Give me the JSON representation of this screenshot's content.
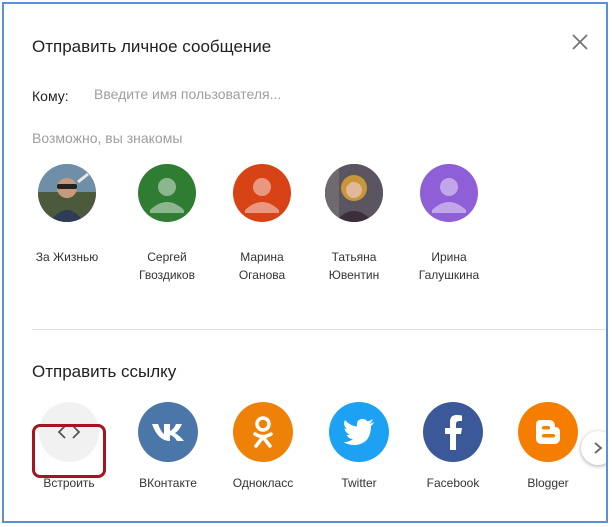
{
  "dialog": {
    "title": "Отправить личное сообщение",
    "to_label": "Кому:",
    "to_placeholder": "Введите имя пользователя...",
    "suggest_label": "Возможно, вы знакомы"
  },
  "contacts": [
    {
      "name_line1": "За Жизнью",
      "name_line2": "",
      "avatar": "photo-man",
      "color": "#6d7c8c"
    },
    {
      "name_line1": "Сергей",
      "name_line2": "Гвоздиков",
      "avatar": "default-user",
      "color": "#2e7d32"
    },
    {
      "name_line1": "Марина",
      "name_line2": "Оганова",
      "avatar": "default-user",
      "color": "#d84315"
    },
    {
      "name_line1": "Татьяна",
      "name_line2": "Ювентин",
      "avatar": "photo-woman",
      "color": "#4a4a5a"
    },
    {
      "name_line1": "Ирина",
      "name_line2": "Галушкина",
      "avatar": "default-user",
      "color": "#8e5fd6"
    }
  ],
  "share": {
    "title": "Отправить ссылку",
    "items": [
      {
        "label": "Встроить",
        "icon": "embed-icon",
        "color": "#f1f1f1"
      },
      {
        "label": "ВКонтакте",
        "icon": "vk-icon",
        "color": "#4a76a8"
      },
      {
        "label": "Однокласс",
        "icon": "odnoklassniki-icon",
        "color": "#ee8208"
      },
      {
        "label": "Twitter",
        "icon": "twitter-icon",
        "color": "#1da1f2"
      },
      {
        "label": "Facebook",
        "icon": "facebook-icon",
        "color": "#3b5998"
      },
      {
        "label": "Blogger",
        "icon": "blogger-icon",
        "color": "#f57d00"
      }
    ]
  },
  "colors": {
    "highlight": "#a31621",
    "frame": "#5b8fd6"
  }
}
